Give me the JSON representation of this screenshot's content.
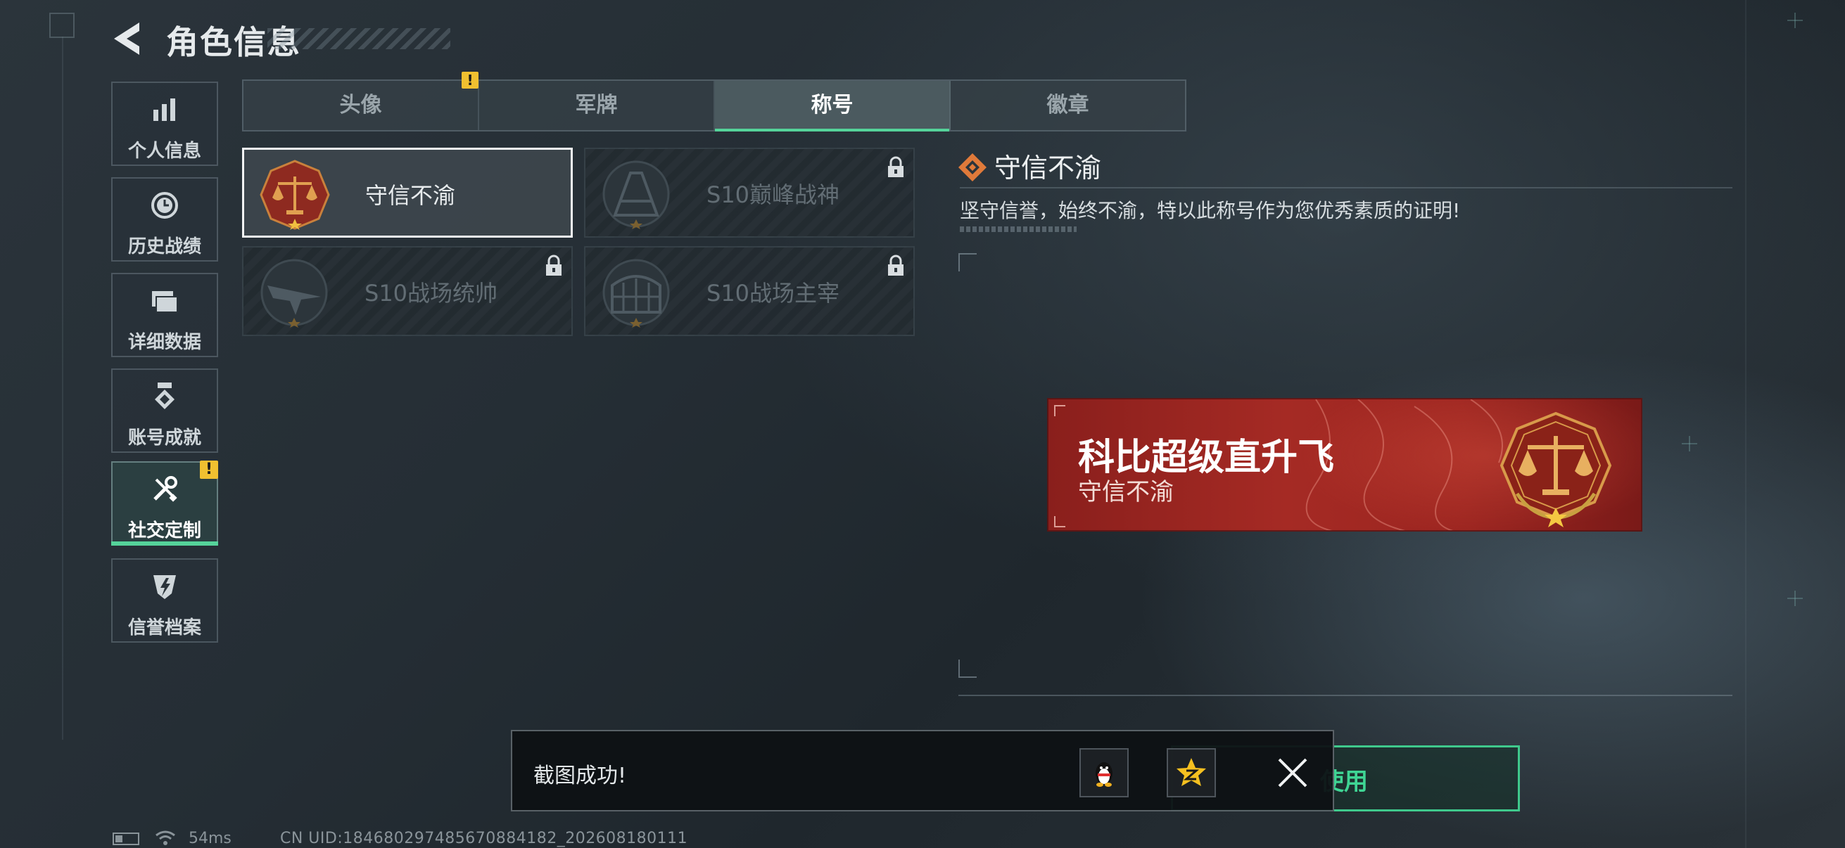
{
  "header": {
    "title": "角色信息"
  },
  "sidebar": {
    "items": [
      {
        "label": "个人信息",
        "icon": "bar-chart-icon"
      },
      {
        "label": "历史战绩",
        "icon": "history-icon"
      },
      {
        "label": "详细数据",
        "icon": "folder-icon"
      },
      {
        "label": "账号成就",
        "icon": "medal-icon"
      },
      {
        "label": "社交定制",
        "icon": "tools-icon",
        "active": true,
        "alert": "!"
      },
      {
        "label": "信誉档案",
        "icon": "shield-emblem-icon"
      }
    ]
  },
  "tabs": [
    {
      "label": "头像",
      "alert": "!"
    },
    {
      "label": "军牌"
    },
    {
      "label": "称号",
      "active": true
    },
    {
      "label": "徽章"
    }
  ],
  "titles": [
    {
      "name": "守信不渝",
      "selected": true,
      "locked": false
    },
    {
      "name": "S10巅峰战神",
      "locked": true
    },
    {
      "name": "S10战场统帅",
      "locked": true
    },
    {
      "name": "S10战场主宰",
      "locked": true
    }
  ],
  "detail": {
    "title": "守信不渝",
    "description": "坚守信誉，始终不渝，特以此称号作为您优秀素质的证明!"
  },
  "preview": {
    "player_name": "科比超级直升飞",
    "title": "守信不渝"
  },
  "toast": {
    "message": "截图成功!"
  },
  "use_button": {
    "label": "使用"
  },
  "status": {
    "ping": "54ms",
    "uid": "CN UID:18468029748567088418​2_202608180111"
  },
  "colors": {
    "accent": "#55d39a",
    "banner_red": "#a52a24",
    "warning": "#f0c030"
  }
}
